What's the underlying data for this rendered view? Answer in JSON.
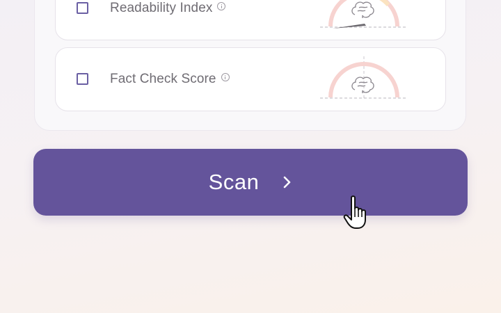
{
  "metrics": [
    {
      "label": "Readability Index",
      "checked": false,
      "gauge_level": 0.08
    },
    {
      "label": "Fact Check Score",
      "checked": false,
      "gauge_level": null
    }
  ],
  "scan_button": {
    "label": "Scan"
  },
  "icons": {
    "checkbox": "checkbox-icon",
    "info": "info-icon",
    "gauge": "brain-gauge-icon",
    "chevron": "chevron-right-icon",
    "cursor": "hand-pointer-cursor-icon"
  },
  "colors": {
    "accent": "#64549b",
    "checkbox_border": "#6a5fa3",
    "gauge_arc": "#f7d3d0",
    "gauge_accent": "#fbe3c0",
    "text_muted": "#6f6c73"
  }
}
